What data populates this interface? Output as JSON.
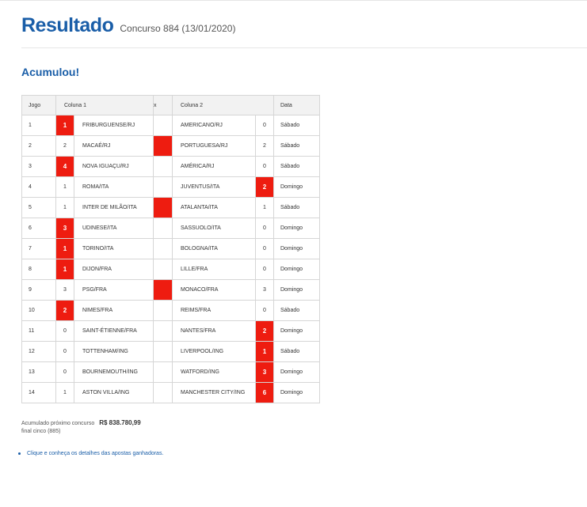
{
  "header": {
    "title": "Resultado",
    "subtitle": "Concurso 884 (13/01/2020)"
  },
  "status": "Acumulou!",
  "table": {
    "headers": {
      "jogo": "Jogo",
      "coluna1": "Coluna 1",
      "x": "x",
      "coluna2": "Coluna 2",
      "data": "Data"
    },
    "rows": [
      {
        "jogo": "1",
        "g1": "1",
        "t1": "FRIBURGUENSE/RJ",
        "x": "",
        "t2": "AMERICANO/RJ",
        "g2": "0",
        "day": "Sábado",
        "win": "1"
      },
      {
        "jogo": "2",
        "g1": "2",
        "t1": "MACAÉ/RJ",
        "x": "",
        "t2": "PORTUGUESA/RJ",
        "g2": "2",
        "day": "Sábado",
        "win": "x"
      },
      {
        "jogo": "3",
        "g1": "4",
        "t1": "NOVA IGUAÇU/RJ",
        "x": "",
        "t2": "AMÉRICA/RJ",
        "g2": "0",
        "day": "Sábado",
        "win": "1"
      },
      {
        "jogo": "4",
        "g1": "1",
        "t1": "ROMA/ITA",
        "x": "",
        "t2": "JUVENTUS/ITA",
        "g2": "2",
        "day": "Domingo",
        "win": "2"
      },
      {
        "jogo": "5",
        "g1": "1",
        "t1": "INTER DE MILÃO/ITA",
        "x": "",
        "t2": "ATALANTA/ITA",
        "g2": "1",
        "day": "Sábado",
        "win": "x"
      },
      {
        "jogo": "6",
        "g1": "3",
        "t1": "UDINESE/ITA",
        "x": "",
        "t2": "SASSUOLO/ITA",
        "g2": "0",
        "day": "Domingo",
        "win": "1"
      },
      {
        "jogo": "7",
        "g1": "1",
        "t1": "TORINO/ITA",
        "x": "",
        "t2": "BOLOGNA/ITA",
        "g2": "0",
        "day": "Domingo",
        "win": "1"
      },
      {
        "jogo": "8",
        "g1": "1",
        "t1": "DIJON/FRA",
        "x": "",
        "t2": "LILLE/FRA",
        "g2": "0",
        "day": "Domingo",
        "win": "1"
      },
      {
        "jogo": "9",
        "g1": "3",
        "t1": "PSG/FRA",
        "x": "",
        "t2": "MONACO/FRA",
        "g2": "3",
        "day": "Domingo",
        "win": "x"
      },
      {
        "jogo": "10",
        "g1": "2",
        "t1": "NIMES/FRA",
        "x": "",
        "t2": "REIMS/FRA",
        "g2": "0",
        "day": "Sábado",
        "win": "1"
      },
      {
        "jogo": "11",
        "g1": "0",
        "t1": "SAINT-ÉTIENNE/FRA",
        "x": "",
        "t2": "NANTES/FRA",
        "g2": "2",
        "day": "Domingo",
        "win": "2"
      },
      {
        "jogo": "12",
        "g1": "0",
        "t1": "TOTTENHAM/ING",
        "x": "",
        "t2": "LIVERPOOL/ING",
        "g2": "1",
        "day": "Sábado",
        "win": "2"
      },
      {
        "jogo": "13",
        "g1": "0",
        "t1": "BOURNEMOUTH/ING",
        "x": "",
        "t2": "WATFORD/ING",
        "g2": "3",
        "day": "Domingo",
        "win": "2"
      },
      {
        "jogo": "14",
        "g1": "1",
        "t1": "ASTON VILLA/ING",
        "x": "",
        "t2": "MANCHESTER CITY/ING",
        "g2": "6",
        "day": "Domingo",
        "win": "2"
      }
    ]
  },
  "footer": {
    "label": "Acumulado próximo concurso",
    "amount": "R$ 838.780,99",
    "note": "final cinco (885)"
  },
  "link": "Clique e conheça os detalhes das apostas ganhadoras.",
  "colors": {
    "brand": "#1a5ea8",
    "winner": "#ee1c10"
  }
}
